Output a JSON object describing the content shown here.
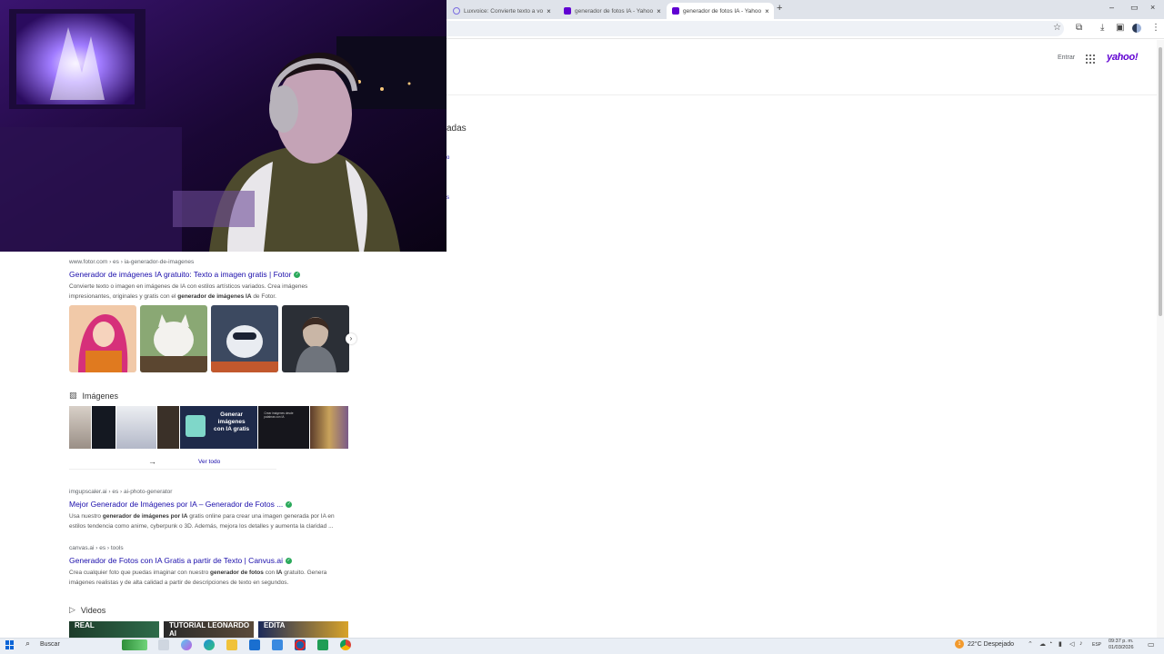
{
  "browser": {
    "tabs": [
      {
        "title": "Luxvoice: Convierte texto a vo",
        "close": "×",
        "active": false
      },
      {
        "title": "generador de fotos IA - Yahoo",
        "close": "×",
        "active": false
      },
      {
        "title": "generador de fotos IA - Yahoo",
        "close": "×",
        "active": true
      }
    ],
    "new_tab": "+",
    "window_controls": [
      "–",
      "▭",
      "×"
    ],
    "toolbar_icons": [
      "star-icon",
      "extensions-icon",
      "download-icon",
      "save-icon",
      "profile-icon",
      "menu-icon"
    ]
  },
  "yahoo": {
    "signin": "Entrar",
    "logo": "yahoo!"
  },
  "peek": {
    "line1": "adas",
    "line2": "o",
    "line3": "s"
  },
  "results": [
    {
      "crumb": "www.fotor.com › es › ia-generador-de-imagenes",
      "title": "Generador de imágenes IA gratuito: Texto a imagen gratis | Fotor",
      "snippet_1": "Convierte texto o imagen en imágenes de IA con estilos artísticos variados. Crea imágenes",
      "snippet_2a": "impresionantes, originales y gratis con el ",
      "snippet_2b": "generador de imágenes IA",
      "snippet_2c": " de Fotor."
    },
    {
      "crumb": "imgupscaler.ai › es › ai-photo-generator",
      "title": "Mejor Generador de Imágenes por IA – Generador de Fotos ...",
      "snippet_1a": "Usa nuestro ",
      "snippet_1b": "generador de imágenes por IA",
      "snippet_1c": " gratis online para crear una imagen generada por IA en",
      "snippet_2": "estilos tendencia como anime, cyberpunk o 3D. Además, mejora los detalles y aumenta la claridad ..."
    },
    {
      "crumb": "canvas.ai › es › tools",
      "title": "Generador de Fotos con IA Gratis a partir de Texto | Canvus.ai",
      "snippet_1a": "Crea cualquier foto que puedas imaginar con nuestro ",
      "snippet_1b": "generador de fotos",
      "snippet_1c": " con ",
      "snippet_1d": "IA",
      "snippet_1e": " gratuito. Genera",
      "snippet_2": "imágenes realistas y de alta calidad a partir de descripciones de texto en segundos."
    }
  ],
  "images_section": {
    "heading": "Imágenes",
    "promo_line1": "Generar",
    "promo_line2": "imágenes",
    "promo_line3": "con IA gratis",
    "promo_small": "Crear imágenes desde palabras con IA",
    "ver_todo": "Ver todo"
  },
  "videos_section": {
    "heading": "Videos",
    "thumbs": [
      "REAL",
      "TUTORIAL LEONARDO AI",
      "EDITA"
    ]
  },
  "taskbar": {
    "search": "Buscar",
    "weather": "22°C  Despejado",
    "lang": "ESP",
    "time": "09:37 p. m.",
    "date": "01/03/2026",
    "weather_badge": "1"
  },
  "colors": {
    "link": "#1a0dab",
    "yahoo_purple": "#6001d2",
    "verified_green": "#2aa95b"
  }
}
